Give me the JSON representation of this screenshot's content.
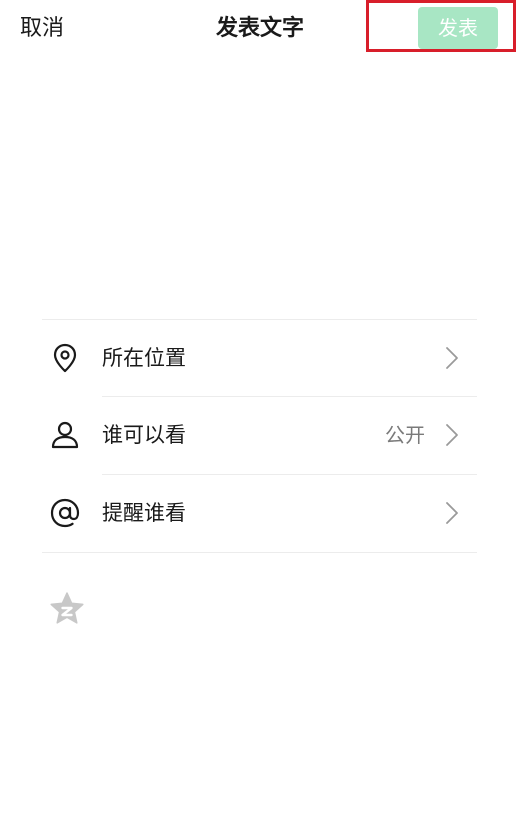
{
  "header": {
    "cancel_label": "取消",
    "title": "发表文字",
    "publish_label": "发表"
  },
  "options": [
    {
      "label": "所在位置",
      "value": "",
      "icon": "location-pin-icon"
    },
    {
      "label": "谁可以看",
      "value": "公开",
      "icon": "person-icon"
    },
    {
      "label": "提醒谁看",
      "value": "",
      "icon": "at-sign-icon"
    }
  ],
  "toolbar": {
    "emoji_icon": "emoji-icon"
  },
  "colors": {
    "publish_button_bg": "#a8e6c4",
    "highlight_border": "#d81e2a",
    "divider": "#ececec",
    "value_text": "#7a7a7a"
  }
}
